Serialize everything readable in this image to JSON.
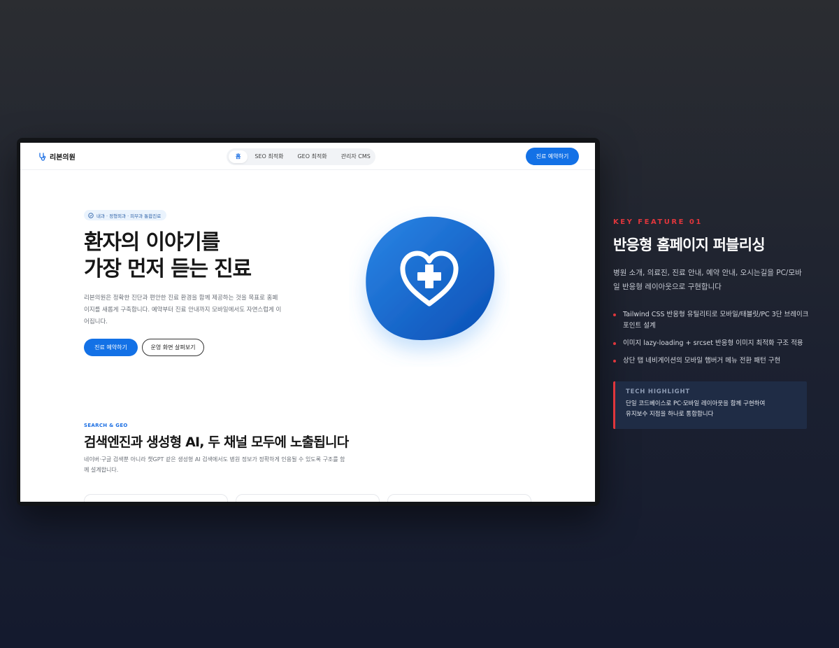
{
  "site": {
    "logo_text": "리본의원",
    "tabs": [
      {
        "label": "홈",
        "active": true
      },
      {
        "label": "SEO 최적화",
        "active": false
      },
      {
        "label": "GEO 최적화",
        "active": false
      },
      {
        "label": "관리자 CMS",
        "active": false
      }
    ],
    "nav_cta": "진료 예약하기",
    "hero": {
      "badge": "내과 · 정형외과 · 피부과 통합진료",
      "title_line1": "환자의 이야기를",
      "title_line2": "가장 먼저 듣는 진료",
      "description": "리본의원은 정확한 진단과 편안한 진료 환경을 함께 제공하는 것을 목표로 홈페이지를 새롭게 구축합니다. 예약부터 진료 안내까지 모바일에서도 자연스럽게 이어집니다.",
      "primary_button": "진료 예약하기",
      "secondary_button": "운영 화면 살펴보기"
    },
    "section": {
      "eyebrow": "SEARCH & GEO",
      "title": "검색엔진과 생성형 AI, 두 채널 모두에 노출됩니다",
      "description": "네이버·구글 검색뿐 아니라 챗GPT 같은 생성형 AI 검색에서도 병원 정보가 정확하게 인용될 수 있도록 구조를 함께 설계합니다."
    }
  },
  "feature": {
    "label": "KEY FEATURE 01",
    "title": "반응형 홈페이지 퍼블리싱",
    "description": "병원 소개, 의료진, 진료 안내, 예약 안내, 오시는길을 PC/모바일 반응형 레이아웃으로 구현합니다",
    "bullets": [
      "Tailwind CSS 반응형 유틸리티로 모바일/태블릿/PC 3단 브레이크포인트 설계",
      "이미지 lazy-loading + srcset 반응형 이미지 최적화 구조 적용",
      "상단 탭 네비게이션의 모바일 햄버거 메뉴 전환 패턴 구현"
    ],
    "highlight": {
      "label": "TECH HIGHLIGHT",
      "line1": "단일 코드베이스로 PC·모바일 레이아웃을 함께 구현하여",
      "line2": "유지보수 지점을 하나로 통합합니다"
    }
  },
  "colors": {
    "brand_blue": "#1371e6",
    "accent_red": "#e0363c"
  },
  "icons": {
    "logo": "stethoscope-icon",
    "badge": "check-circle-icon",
    "hero_graphic": "heart-medical-cross-icon"
  }
}
